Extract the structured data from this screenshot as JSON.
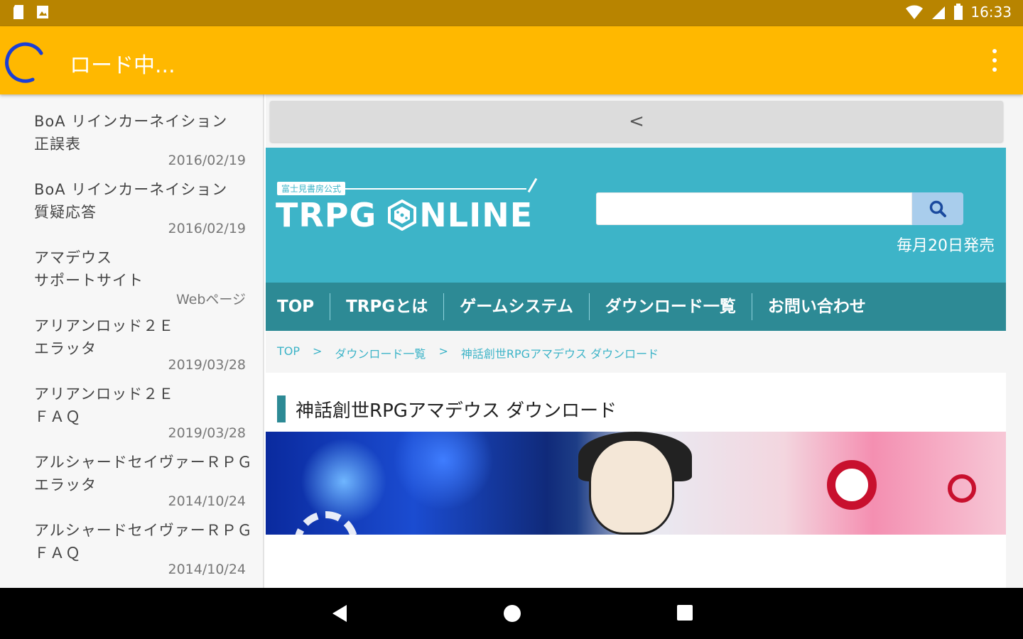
{
  "status_bar": {
    "time": "16:33"
  },
  "app_bar": {
    "title": "ロード中..."
  },
  "sidebar": {
    "items": [
      {
        "line1": "BoA リインカーネイション",
        "line2": "正誤表",
        "date": "2016/02/19"
      },
      {
        "line1": "BoA リインカーネイション",
        "line2": "質疑応答",
        "date": "2016/02/19"
      },
      {
        "line1": "アマデウス",
        "line2": "サポートサイト",
        "date": "Webページ"
      },
      {
        "line1": "アリアンロッド２Ｅ",
        "line2": "エラッタ",
        "date": "2019/03/28"
      },
      {
        "line1": "アリアンロッド２Ｅ",
        "line2": "ＦＡＱ",
        "date": "2019/03/28"
      },
      {
        "line1": "アルシャードセイヴァーＲＰＧ",
        "line2": "エラッタ",
        "date": "2014/10/24"
      },
      {
        "line1": "アルシャードセイヴァーＲＰＧ",
        "line2": "ＦＡＱ",
        "date": "2014/10/24"
      }
    ]
  },
  "webview": {
    "back_label": "<",
    "logo": {
      "tag": "富士見書房公式",
      "left": "TRPG ",
      "right": "NLINE"
    },
    "search": {
      "placeholder": ""
    },
    "release_text": "毎月20日発売",
    "nav": [
      "TOP",
      "TRPGとは",
      "ゲームシステム",
      "ダウンロード一覧",
      "お問い合わせ"
    ],
    "breadcrumb": [
      "TOP",
      ">",
      "ダウンロード一覧",
      ">",
      "神話創世RPGアマデウス ダウンロード"
    ],
    "page_heading": "神話創世RPGアマデウス ダウンロード"
  }
}
